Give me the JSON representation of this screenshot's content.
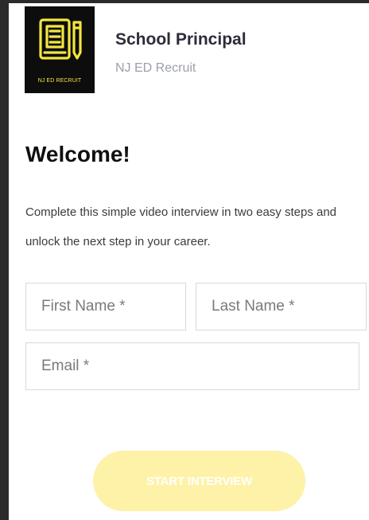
{
  "brand": {
    "logo_text": "NJ ED RECRUIT",
    "logo_color": "#f2e640",
    "logo_bg": "#0d0d0d"
  },
  "header": {
    "job_title": "School Principal",
    "company": "NJ ED Recruit"
  },
  "main": {
    "heading": "Welcome!",
    "intro": "Complete this simple video interview in two easy steps and unlock the next step in your career."
  },
  "form": {
    "first_name": {
      "value": "",
      "placeholder": "First Name *"
    },
    "last_name": {
      "value": "",
      "placeholder": "Last Name *"
    },
    "email": {
      "value": "",
      "placeholder": "Email *"
    }
  },
  "actions": {
    "start_label": "START INTERVIEW",
    "start_color": "#fdf2a8"
  }
}
